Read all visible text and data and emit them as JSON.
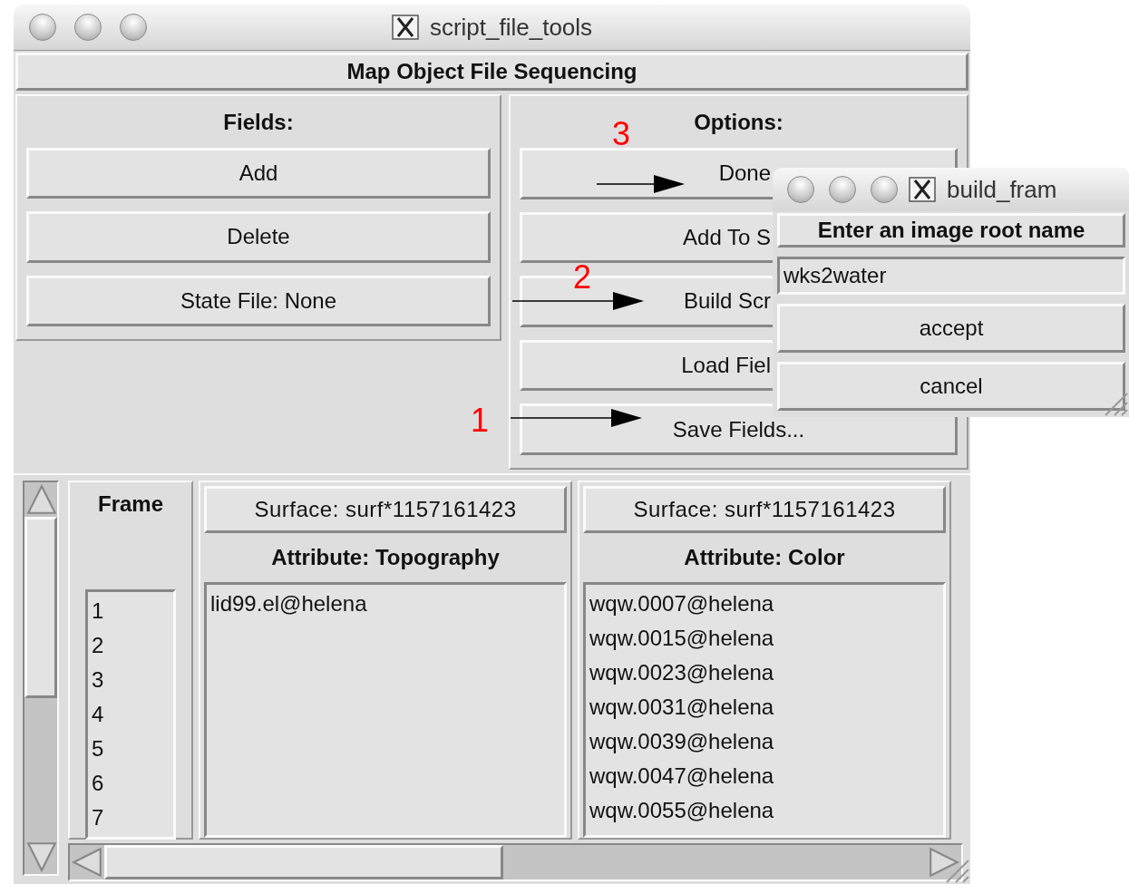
{
  "window": {
    "title": "script_file_tools"
  },
  "header": "Map Object File Sequencing",
  "fields_panel": {
    "title": "Fields:",
    "buttons": [
      "Add",
      "Delete",
      "State File: None"
    ]
  },
  "options_panel": {
    "title": "Options:",
    "buttons": [
      "Done",
      "Add To S",
      "Build Scr",
      "Load Fiel",
      "Save Fields..."
    ]
  },
  "frame_column": {
    "title": "Frame",
    "frames": [
      "1",
      "2",
      "3",
      "4",
      "5",
      "6",
      "7"
    ]
  },
  "surfaces": [
    {
      "surface_button": "Surface: surf*1157161423",
      "attribute": "Attribute: Topography",
      "entries": [
        "lid99.el@helena"
      ]
    },
    {
      "surface_button": "Surface: surf*1157161423",
      "attribute": "Attribute: Color",
      "entries": [
        "wqw.0007@helena",
        "wqw.0015@helena",
        "wqw.0023@helena",
        "wqw.0031@helena",
        "wqw.0039@helena",
        "wqw.0047@helena",
        "wqw.0055@helena"
      ]
    }
  ],
  "annotations": [
    {
      "label": "3"
    },
    {
      "label": "2"
    },
    {
      "label": "1"
    }
  ],
  "dialog": {
    "title": "build_fram",
    "prompt": "Enter an image root name",
    "value": "wks2water",
    "buttons": [
      "accept",
      "cancel"
    ]
  }
}
